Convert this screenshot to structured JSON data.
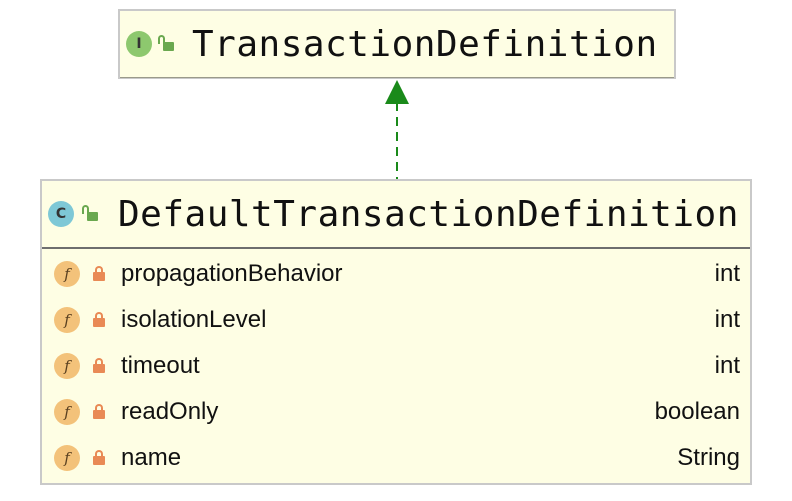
{
  "interface": {
    "kind_letter": "I",
    "name": "TransactionDefinition",
    "icon": "interface-icon",
    "visibility_icon": "unlocked-public-icon"
  },
  "class": {
    "kind_letter": "C",
    "name": "DefaultTransactionDefinition",
    "icon": "class-icon",
    "visibility_icon": "unlocked-public-icon",
    "fields": [
      {
        "badge": "f",
        "name": "propagationBehavior",
        "type": "int"
      },
      {
        "badge": "f",
        "name": "isolationLevel",
        "type": "int"
      },
      {
        "badge": "f",
        "name": "timeout",
        "type": "int"
      },
      {
        "badge": "f",
        "name": "readOnly",
        "type": "boolean"
      },
      {
        "badge": "f",
        "name": "name",
        "type": "String"
      }
    ]
  },
  "relation": {
    "type": "implements",
    "style": "dashed",
    "color": "#1a8a1a"
  },
  "colors": {
    "node_bg": "#fefee4",
    "border": "#c9c9c9",
    "field_badge": "#f3c27a",
    "lock": "#e98a55",
    "unlock": "#6aa84f"
  }
}
